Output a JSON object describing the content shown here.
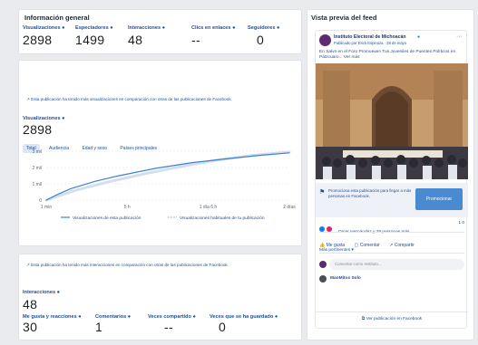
{
  "general": {
    "title": "Información general",
    "metrics": [
      {
        "label": "Visualizaciones",
        "value": "2898"
      },
      {
        "label": "Espectadores",
        "value": "1499"
      },
      {
        "label": "Interacciones",
        "value": "48"
      },
      {
        "label": "Clics en enlaces",
        "value": "--"
      },
      {
        "label": "Seguidores",
        "value": "0"
      }
    ]
  },
  "views": {
    "note": "Esta publicación ha tenido más visualizaciones en comparación con otras de las publicaciones de Facebook.",
    "label": "Visualizaciones",
    "value": "2898",
    "tabs": [
      "Total",
      "Audiencia",
      "Edad y sexo",
      "Países principales"
    ],
    "active_tab": "Total"
  },
  "chart_data": {
    "type": "line",
    "x": [
      "1 min",
      "5 h",
      "1 día 6 h",
      "2 días"
    ],
    "y_ticks": [
      "0",
      "1 mil",
      "2 mil",
      "3 mil"
    ],
    "ylim": [
      0,
      3000
    ],
    "series": [
      {
        "name": "Visualizaciones de esta publicación",
        "color": "#3b82d8",
        "points": [
          [
            0,
            0
          ],
          [
            0.04,
            300
          ],
          [
            0.1,
            700
          ],
          [
            0.2,
            1150
          ],
          [
            0.3,
            1500
          ],
          [
            0.45,
            1950
          ],
          [
            0.6,
            2300
          ],
          [
            0.75,
            2550
          ],
          [
            0.88,
            2750
          ],
          [
            1,
            2898
          ]
        ]
      },
      {
        "name": "Visualizaciones habituales de tu publicación",
        "color": "#b7c9de",
        "points": [
          [
            0,
            0
          ],
          [
            0.05,
            250
          ],
          [
            0.12,
            600
          ],
          [
            0.25,
            1100
          ],
          [
            0.4,
            1600
          ],
          [
            0.55,
            2050
          ],
          [
            0.7,
            2450
          ],
          [
            0.85,
            2750
          ],
          [
            1,
            2950
          ]
        ]
      }
    ]
  },
  "interactions": {
    "note": "Esta publicación ha tenido más interacciones en comparación con otras de las publicaciones de Facebook.",
    "label": "Interacciones",
    "value": "48",
    "breakdown": [
      {
        "label": "Me gusta y reacciones",
        "value": "30"
      },
      {
        "label": "Comentarios",
        "value": "1"
      },
      {
        "label": "Veces compartido",
        "value": "--"
      },
      {
        "label": "Veces que se ha guardado",
        "value": "0"
      }
    ]
  },
  "preview": {
    "title": "Vista previa del feed",
    "page_name": "Instituto Electoral de Michoacán",
    "sub": "Publicado por Erick Espinoza · 28 de mayo",
    "body": "En Salvo en el Foro Promueven Tus Juveniles de Puentes Políticos en Pátzcuaro... Ver más",
    "boost_text": "Promociona esta publicación para llegar a más personas en Facebook.",
    "boost_btn": "Promocionar",
    "reactions": "Omar Hernández y 29 personas más",
    "counts": "1  0",
    "actions": [
      "Me gusta",
      "Comentar",
      "Compartir"
    ],
    "more": "Más pertinentes",
    "comment_placeholder": "Comentar como Instituto...",
    "commenter": "MaoMitos Solo",
    "view_link": "Ver publicación en Facebook"
  }
}
